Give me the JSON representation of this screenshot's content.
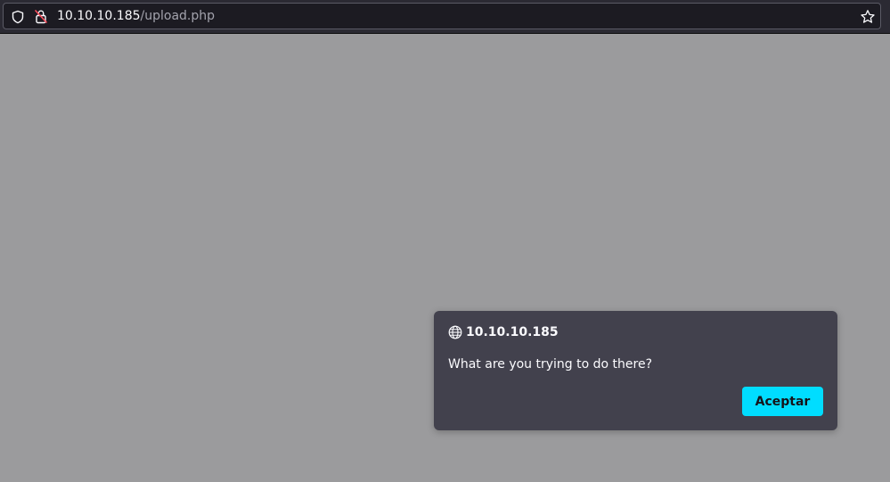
{
  "browser": {
    "url_host": "10.10.10.185",
    "url_path": "/upload.php",
    "icons": {
      "shield": "shield-icon",
      "lock": "insecure-lock-icon",
      "bookmark": "star-icon"
    }
  },
  "dialog": {
    "origin": "10.10.10.185",
    "message": "What are you trying to do there?",
    "accept_label": "Aceptar",
    "icon": "globe-icon",
    "accent_color": "#00ddff"
  }
}
